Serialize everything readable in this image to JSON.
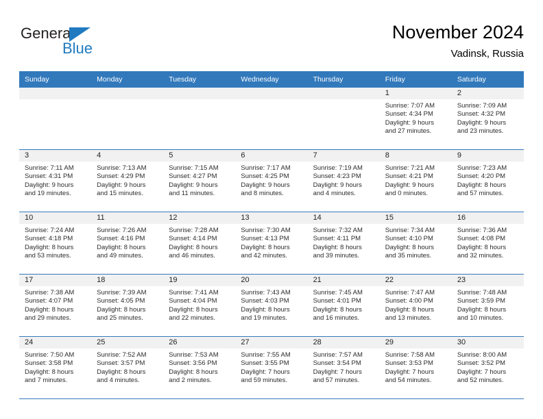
{
  "brand": {
    "name_part1": "General",
    "name_part2": "Blue"
  },
  "header": {
    "title": "November 2024",
    "location": "Vadinsk, Russia"
  },
  "colors": {
    "header_blue": "#3279bc",
    "brand_blue": "#1f7ac0",
    "date_band": "#f1f1f1",
    "text": "#2b2b2b"
  },
  "weekdays": [
    "Sunday",
    "Monday",
    "Tuesday",
    "Wednesday",
    "Thursday",
    "Friday",
    "Saturday"
  ],
  "weeks": [
    [
      {
        "day": ""
      },
      {
        "day": ""
      },
      {
        "day": ""
      },
      {
        "day": ""
      },
      {
        "day": ""
      },
      {
        "day": "1",
        "sunrise": "Sunrise: 7:07 AM",
        "sunset": "Sunset: 4:34 PM",
        "daylight1": "Daylight: 9 hours",
        "daylight2": "and 27 minutes."
      },
      {
        "day": "2",
        "sunrise": "Sunrise: 7:09 AM",
        "sunset": "Sunset: 4:32 PM",
        "daylight1": "Daylight: 9 hours",
        "daylight2": "and 23 minutes."
      }
    ],
    [
      {
        "day": "3",
        "sunrise": "Sunrise: 7:11 AM",
        "sunset": "Sunset: 4:31 PM",
        "daylight1": "Daylight: 9 hours",
        "daylight2": "and 19 minutes."
      },
      {
        "day": "4",
        "sunrise": "Sunrise: 7:13 AM",
        "sunset": "Sunset: 4:29 PM",
        "daylight1": "Daylight: 9 hours",
        "daylight2": "and 15 minutes."
      },
      {
        "day": "5",
        "sunrise": "Sunrise: 7:15 AM",
        "sunset": "Sunset: 4:27 PM",
        "daylight1": "Daylight: 9 hours",
        "daylight2": "and 11 minutes."
      },
      {
        "day": "6",
        "sunrise": "Sunrise: 7:17 AM",
        "sunset": "Sunset: 4:25 PM",
        "daylight1": "Daylight: 9 hours",
        "daylight2": "and 8 minutes."
      },
      {
        "day": "7",
        "sunrise": "Sunrise: 7:19 AM",
        "sunset": "Sunset: 4:23 PM",
        "daylight1": "Daylight: 9 hours",
        "daylight2": "and 4 minutes."
      },
      {
        "day": "8",
        "sunrise": "Sunrise: 7:21 AM",
        "sunset": "Sunset: 4:21 PM",
        "daylight1": "Daylight: 9 hours",
        "daylight2": "and 0 minutes."
      },
      {
        "day": "9",
        "sunrise": "Sunrise: 7:23 AM",
        "sunset": "Sunset: 4:20 PM",
        "daylight1": "Daylight: 8 hours",
        "daylight2": "and 57 minutes."
      }
    ],
    [
      {
        "day": "10",
        "sunrise": "Sunrise: 7:24 AM",
        "sunset": "Sunset: 4:18 PM",
        "daylight1": "Daylight: 8 hours",
        "daylight2": "and 53 minutes."
      },
      {
        "day": "11",
        "sunrise": "Sunrise: 7:26 AM",
        "sunset": "Sunset: 4:16 PM",
        "daylight1": "Daylight: 8 hours",
        "daylight2": "and 49 minutes."
      },
      {
        "day": "12",
        "sunrise": "Sunrise: 7:28 AM",
        "sunset": "Sunset: 4:14 PM",
        "daylight1": "Daylight: 8 hours",
        "daylight2": "and 46 minutes."
      },
      {
        "day": "13",
        "sunrise": "Sunrise: 7:30 AM",
        "sunset": "Sunset: 4:13 PM",
        "daylight1": "Daylight: 8 hours",
        "daylight2": "and 42 minutes."
      },
      {
        "day": "14",
        "sunrise": "Sunrise: 7:32 AM",
        "sunset": "Sunset: 4:11 PM",
        "daylight1": "Daylight: 8 hours",
        "daylight2": "and 39 minutes."
      },
      {
        "day": "15",
        "sunrise": "Sunrise: 7:34 AM",
        "sunset": "Sunset: 4:10 PM",
        "daylight1": "Daylight: 8 hours",
        "daylight2": "and 35 minutes."
      },
      {
        "day": "16",
        "sunrise": "Sunrise: 7:36 AM",
        "sunset": "Sunset: 4:08 PM",
        "daylight1": "Daylight: 8 hours",
        "daylight2": "and 32 minutes."
      }
    ],
    [
      {
        "day": "17",
        "sunrise": "Sunrise: 7:38 AM",
        "sunset": "Sunset: 4:07 PM",
        "daylight1": "Daylight: 8 hours",
        "daylight2": "and 29 minutes."
      },
      {
        "day": "18",
        "sunrise": "Sunrise: 7:39 AM",
        "sunset": "Sunset: 4:05 PM",
        "daylight1": "Daylight: 8 hours",
        "daylight2": "and 25 minutes."
      },
      {
        "day": "19",
        "sunrise": "Sunrise: 7:41 AM",
        "sunset": "Sunset: 4:04 PM",
        "daylight1": "Daylight: 8 hours",
        "daylight2": "and 22 minutes."
      },
      {
        "day": "20",
        "sunrise": "Sunrise: 7:43 AM",
        "sunset": "Sunset: 4:03 PM",
        "daylight1": "Daylight: 8 hours",
        "daylight2": "and 19 minutes."
      },
      {
        "day": "21",
        "sunrise": "Sunrise: 7:45 AM",
        "sunset": "Sunset: 4:01 PM",
        "daylight1": "Daylight: 8 hours",
        "daylight2": "and 16 minutes."
      },
      {
        "day": "22",
        "sunrise": "Sunrise: 7:47 AM",
        "sunset": "Sunset: 4:00 PM",
        "daylight1": "Daylight: 8 hours",
        "daylight2": "and 13 minutes."
      },
      {
        "day": "23",
        "sunrise": "Sunrise: 7:48 AM",
        "sunset": "Sunset: 3:59 PM",
        "daylight1": "Daylight: 8 hours",
        "daylight2": "and 10 minutes."
      }
    ],
    [
      {
        "day": "24",
        "sunrise": "Sunrise: 7:50 AM",
        "sunset": "Sunset: 3:58 PM",
        "daylight1": "Daylight: 8 hours",
        "daylight2": "and 7 minutes."
      },
      {
        "day": "25",
        "sunrise": "Sunrise: 7:52 AM",
        "sunset": "Sunset: 3:57 PM",
        "daylight1": "Daylight: 8 hours",
        "daylight2": "and 4 minutes."
      },
      {
        "day": "26",
        "sunrise": "Sunrise: 7:53 AM",
        "sunset": "Sunset: 3:56 PM",
        "daylight1": "Daylight: 8 hours",
        "daylight2": "and 2 minutes."
      },
      {
        "day": "27",
        "sunrise": "Sunrise: 7:55 AM",
        "sunset": "Sunset: 3:55 PM",
        "daylight1": "Daylight: 7 hours",
        "daylight2": "and 59 minutes."
      },
      {
        "day": "28",
        "sunrise": "Sunrise: 7:57 AM",
        "sunset": "Sunset: 3:54 PM",
        "daylight1": "Daylight: 7 hours",
        "daylight2": "and 57 minutes."
      },
      {
        "day": "29",
        "sunrise": "Sunrise: 7:58 AM",
        "sunset": "Sunset: 3:53 PM",
        "daylight1": "Daylight: 7 hours",
        "daylight2": "and 54 minutes."
      },
      {
        "day": "30",
        "sunrise": "Sunrise: 8:00 AM",
        "sunset": "Sunset: 3:52 PM",
        "daylight1": "Daylight: 7 hours",
        "daylight2": "and 52 minutes."
      }
    ]
  ]
}
